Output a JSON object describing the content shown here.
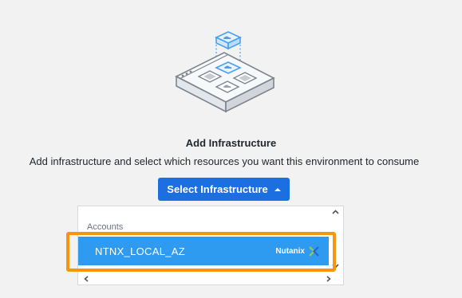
{
  "empty_state": {
    "title": "Add Infrastructure",
    "description": "Add infrastructure and select which resources you want this environment to consume",
    "illustration": "infrastructure-stack-illustration"
  },
  "select_button": {
    "label": "Select Infrastructure",
    "icon": "caret-up-icon",
    "expanded": true
  },
  "dropdown": {
    "section_label": "Accounts",
    "accounts": [
      {
        "name": "NTNX_LOCAL_AZ",
        "provider": "Nutanix",
        "provider_icon": "nutanix-x-icon",
        "highlighted": true
      }
    ]
  },
  "colors": {
    "primary_button": "#1b6fe0",
    "row_selected": "#2f9bf0",
    "highlight_frame": "#f7960e",
    "background": "#f2f2f2",
    "nutanix_green": "#9ccb3c",
    "nutanix_blue": "#2a64cf"
  }
}
